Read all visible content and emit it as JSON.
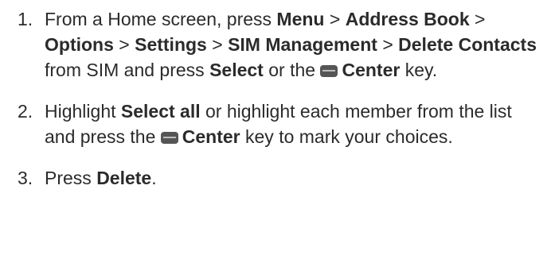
{
  "steps": [
    {
      "number": "1.",
      "parts": [
        {
          "t": "From a Home screen, press ",
          "b": false
        },
        {
          "t": "Menu",
          "b": true
        },
        {
          "t": " > ",
          "b": false
        },
        {
          "t": "Address Book",
          "b": true
        },
        {
          "t": " > ",
          "b": false
        },
        {
          "t": "Options",
          "b": true
        },
        {
          "t": " > ",
          "b": false
        },
        {
          "t": "Settings",
          "b": true
        },
        {
          "t": " > ",
          "b": false
        },
        {
          "t": "SIM Management",
          "b": true
        },
        {
          "t": " > ",
          "b": false
        },
        {
          "t": "Delete Contacts",
          "b": true
        },
        {
          "t": " from SIM and press ",
          "b": false
        },
        {
          "t": "Select",
          "b": true
        },
        {
          "t": " or the ",
          "b": false
        },
        {
          "icon": "center-key-icon"
        },
        {
          "t": "Center",
          "b": true
        },
        {
          "t": " key.",
          "b": false
        }
      ]
    },
    {
      "number": "2.",
      "parts": [
        {
          "t": "Highlight ",
          "b": false
        },
        {
          "t": "Select all",
          "b": true
        },
        {
          "t": " or highlight each member from the list and press the ",
          "b": false
        },
        {
          "icon": "center-key-icon"
        },
        {
          "t": "Center",
          "b": true
        },
        {
          "t": " key to mark your choices.",
          "b": false
        }
      ]
    },
    {
      "number": "3.",
      "parts": [
        {
          "t": "Press ",
          "b": false
        },
        {
          "t": "Delete",
          "b": true
        },
        {
          "t": ".",
          "b": false
        }
      ]
    }
  ]
}
